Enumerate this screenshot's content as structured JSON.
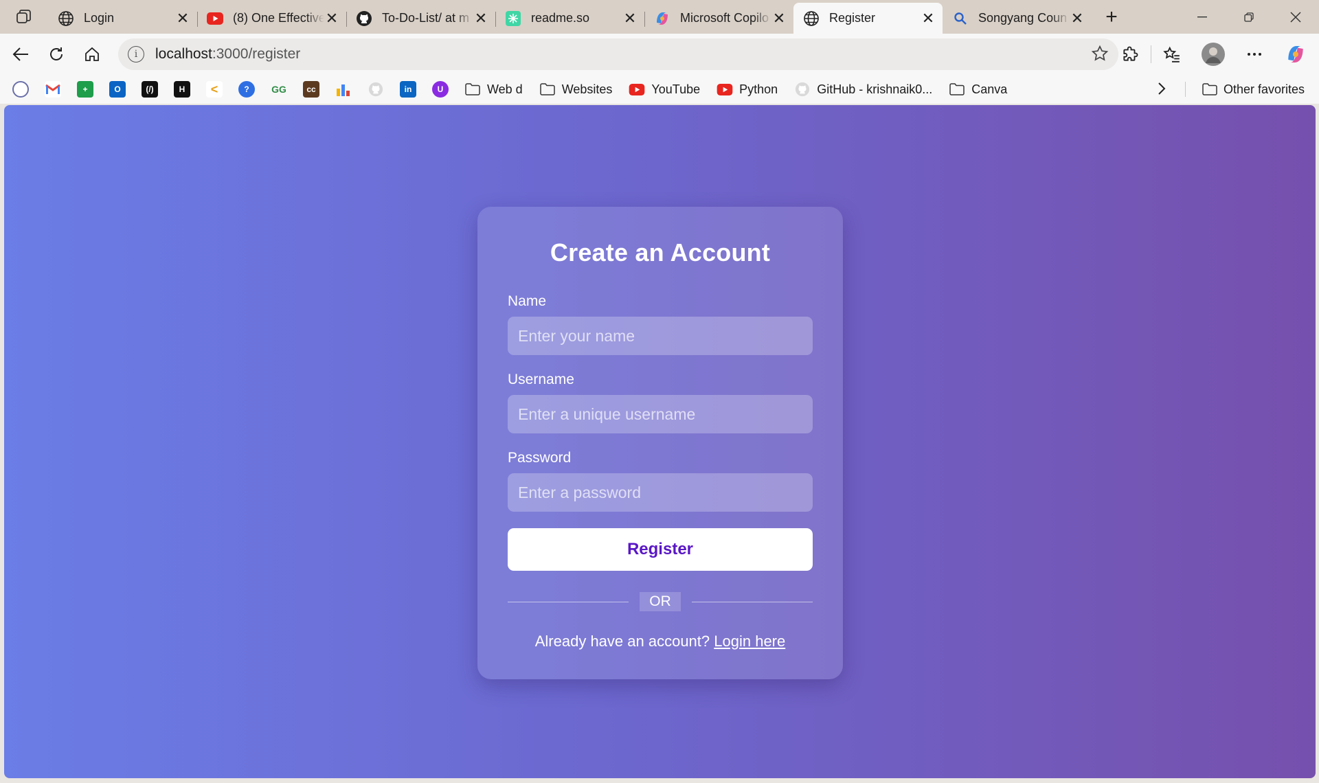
{
  "browser": {
    "tabs": [
      {
        "title": "Login",
        "icon": "globe-icon"
      },
      {
        "title": "(8) One Effective",
        "icon": "youtube-icon"
      },
      {
        "title": "To-Do-List/ at m",
        "icon": "github-icon"
      },
      {
        "title": "readme.so",
        "icon": "readme-icon"
      },
      {
        "title": "Microsoft Copilo",
        "icon": "copilot-icon"
      },
      {
        "title": "Register",
        "icon": "globe-icon",
        "active": true
      },
      {
        "title": "Songyang Coun",
        "icon": "search-icon"
      }
    ],
    "address": {
      "host": "localhost",
      "path": ":3000/register"
    },
    "bookmarks": [
      {
        "label": "Web d",
        "icon": "folder-icon"
      },
      {
        "label": "Websites",
        "icon": "folder-icon"
      },
      {
        "label": "YouTube",
        "icon": "youtube-icon"
      },
      {
        "label": "Python",
        "icon": "youtube-icon"
      },
      {
        "label": "GitHub - krishnaik0...",
        "icon": "github-icon"
      },
      {
        "label": "Canva",
        "icon": "folder-icon"
      }
    ],
    "other_favorites": "Other favorites"
  },
  "page": {
    "title": "Create an Account",
    "fields": {
      "name": {
        "label": "Name",
        "placeholder": "Enter your name",
        "value": ""
      },
      "username": {
        "label": "Username",
        "placeholder": "Enter a unique username",
        "value": ""
      },
      "password": {
        "label": "Password",
        "placeholder": "Enter a password",
        "value": ""
      }
    },
    "register_label": "Register",
    "divider_text": "OR",
    "login_prompt": "Already have an account?",
    "login_link": "Login here"
  },
  "colors": {
    "gradient_start": "#6b7de6",
    "gradient_end": "#7650ad",
    "button_text": "#5a17c6",
    "tabstrip": "#d9d0c7"
  }
}
